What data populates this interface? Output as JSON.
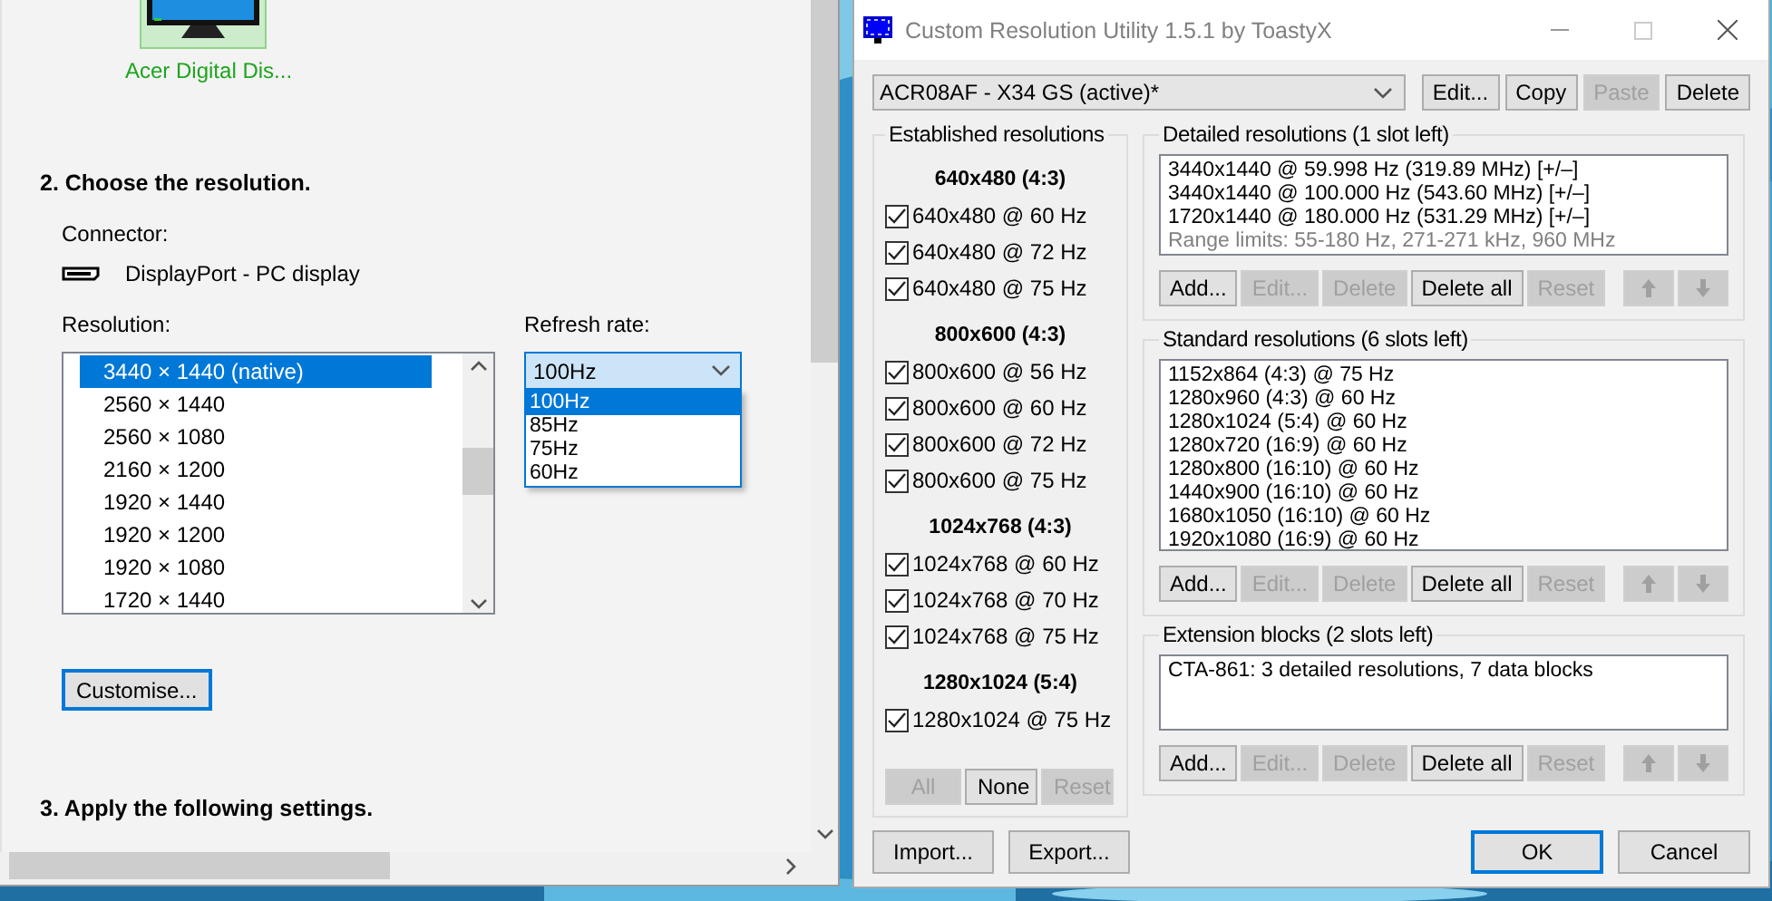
{
  "display_settings": {
    "monitor": {
      "label": "Acer Digital Dis...",
      "selected": true
    },
    "section_2": {
      "heading": "2. Choose the resolution."
    },
    "connector": {
      "label": "Connector:",
      "value": "DisplayPort - PC display"
    },
    "resolution": {
      "label": "Resolution:",
      "items": [
        {
          "text": "3440 × 1440 (native)",
          "selected": true
        },
        {
          "text": "2560 × 1440",
          "selected": false
        },
        {
          "text": "2560 × 1080",
          "selected": false
        },
        {
          "text": "2160 × 1200",
          "selected": false
        },
        {
          "text": "1920 × 1440",
          "selected": false
        },
        {
          "text": "1920 × 1200",
          "selected": false
        },
        {
          "text": "1920 × 1080",
          "selected": false
        },
        {
          "text": "1720 × 1440",
          "selected": false
        }
      ]
    },
    "refresh_rate": {
      "label": "Refresh rate:",
      "value": "100Hz",
      "expanded": true,
      "options": [
        {
          "text": "100Hz",
          "selected": true
        },
        {
          "text": "85Hz",
          "selected": false
        },
        {
          "text": "75Hz",
          "selected": false
        },
        {
          "text": "60Hz",
          "selected": false
        }
      ]
    },
    "customise_button": {
      "label": "Customise...",
      "focused": true
    },
    "section_3": {
      "heading": "3. Apply the following settings."
    }
  },
  "cru": {
    "window": {
      "title": "Custom Resolution Utility 1.5.1 by ToastyX"
    },
    "profile": {
      "value": "ACR08AF - X34 GS (active)*"
    },
    "profile_buttons": [
      {
        "label": "Edit...",
        "disabled": false
      },
      {
        "label": "Copy",
        "disabled": false
      },
      {
        "label": "Paste",
        "disabled": true
      },
      {
        "label": "Delete",
        "disabled": false
      }
    ],
    "established": {
      "title": "Established resolutions",
      "groups": [
        {
          "heading": "640x480 (4:3)",
          "items": [
            {
              "label": "640x480 @ 60 Hz",
              "checked": true
            },
            {
              "label": "640x480 @ 72 Hz",
              "checked": true
            },
            {
              "label": "640x480 @ 75 Hz",
              "checked": true
            }
          ]
        },
        {
          "heading": "800x600 (4:3)",
          "items": [
            {
              "label": "800x600 @ 56 Hz",
              "checked": true
            },
            {
              "label": "800x600 @ 60 Hz",
              "checked": true
            },
            {
              "label": "800x600 @ 72 Hz",
              "checked": true
            },
            {
              "label": "800x600 @ 75 Hz",
              "checked": true
            }
          ]
        },
        {
          "heading": "1024x768 (4:3)",
          "items": [
            {
              "label": "1024x768 @ 60 Hz",
              "checked": true
            },
            {
              "label": "1024x768 @ 70 Hz",
              "checked": true
            },
            {
              "label": "1024x768 @ 75 Hz",
              "checked": true
            }
          ]
        },
        {
          "heading": "1280x1024 (5:4)",
          "items": [
            {
              "label": "1280x1024 @ 75 Hz",
              "checked": true
            }
          ]
        }
      ],
      "buttons": [
        {
          "label": "All",
          "disabled": true
        },
        {
          "label": "None",
          "disabled": false
        },
        {
          "label": "Reset",
          "disabled": true
        }
      ]
    },
    "sections": [
      {
        "title": "Detailed resolutions (1 slot left)",
        "items": [
          {
            "text": "3440x1440 @ 59.998 Hz (319.89 MHz) [+/–]",
            "kind": "entry"
          },
          {
            "text": "3440x1440 @ 100.000 Hz (543.60 MHz) [+/–]",
            "kind": "entry"
          },
          {
            "text": "1720x1440 @ 180.000 Hz (531.29 MHz) [+/–]",
            "kind": "entry"
          },
          {
            "text": "Range limits: 55-180 Hz, 271-271 kHz, 960 MHz",
            "kind": "note"
          }
        ],
        "buttons": [
          {
            "label": "Add...",
            "disabled": false
          },
          {
            "label": "Edit...",
            "disabled": true
          },
          {
            "label": "Delete",
            "disabled": true
          },
          {
            "label": "Delete all",
            "disabled": false
          },
          {
            "label": "Reset",
            "disabled": true
          }
        ],
        "move_disabled": true
      },
      {
        "title": "Standard resolutions (6 slots left)",
        "items": [
          {
            "text": "1152x864 (4:3) @ 75 Hz",
            "kind": "entry"
          },
          {
            "text": "1280x960 (4:3) @ 60 Hz",
            "kind": "entry"
          },
          {
            "text": "1280x1024 (5:4) @ 60 Hz",
            "kind": "entry"
          },
          {
            "text": "1280x720 (16:9) @ 60 Hz",
            "kind": "entry"
          },
          {
            "text": "1280x800 (16:10) @ 60 Hz",
            "kind": "entry"
          },
          {
            "text": "1440x900 (16:10) @ 60 Hz",
            "kind": "entry"
          },
          {
            "text": "1680x1050 (16:10) @ 60 Hz",
            "kind": "entry"
          },
          {
            "text": "1920x1080 (16:9) @ 60 Hz",
            "kind": "entry"
          }
        ],
        "buttons": [
          {
            "label": "Add...",
            "disabled": false
          },
          {
            "label": "Edit...",
            "disabled": true
          },
          {
            "label": "Delete",
            "disabled": true
          },
          {
            "label": "Delete all",
            "disabled": false
          },
          {
            "label": "Reset",
            "disabled": true
          }
        ],
        "move_disabled": true
      },
      {
        "title": "Extension blocks (2 slots left)",
        "items": [
          {
            "text": "CTA-861: 3 detailed resolutions, 7 data blocks",
            "kind": "entry"
          }
        ],
        "buttons": [
          {
            "label": "Add...",
            "disabled": false
          },
          {
            "label": "Edit...",
            "disabled": true
          },
          {
            "label": "Delete",
            "disabled": true
          },
          {
            "label": "Delete all",
            "disabled": false
          },
          {
            "label": "Reset",
            "disabled": true
          }
        ],
        "move_disabled": true
      }
    ],
    "left_buttons": [
      {
        "label": "Import...",
        "focused": false
      },
      {
        "label": "Export...",
        "focused": false
      }
    ],
    "right_buttons": [
      {
        "label": "OK",
        "focused": true
      },
      {
        "label": "Cancel",
        "focused": false
      }
    ]
  }
}
